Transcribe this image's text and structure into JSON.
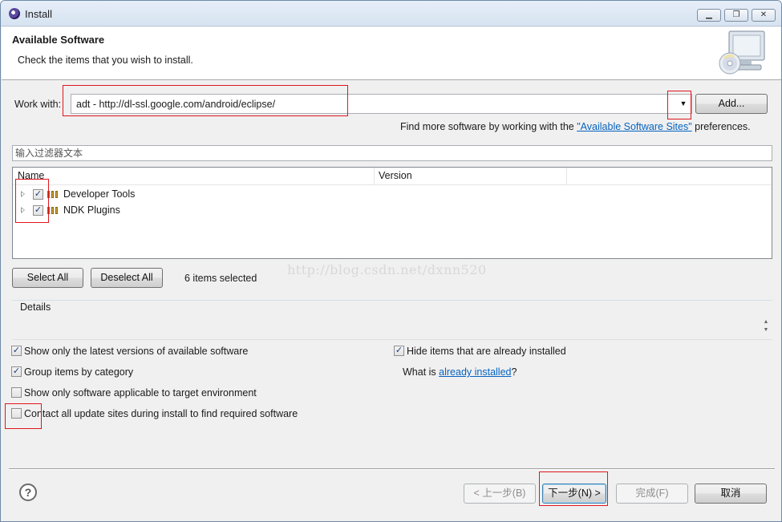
{
  "window": {
    "title": "Install",
    "controls": {
      "minimize": "▁",
      "maximize": "❐",
      "close": "✕"
    }
  },
  "banner": {
    "title": "Available Software",
    "subtitle": "Check the items that you wish to install."
  },
  "work_with": {
    "label": "Work with:",
    "value": "adt - http://dl-ssl.google.com/android/eclipse/",
    "add_button": "Add...",
    "more_text_before": "Find more software by working with the ",
    "more_link": "\"Available Software Sites\"",
    "more_text_after": " preferences."
  },
  "filter": {
    "placeholder": "输入过滤器文本"
  },
  "tree": {
    "columns": [
      "Name",
      "Version"
    ],
    "items": [
      {
        "label": "Developer Tools",
        "checked": true
      },
      {
        "label": "NDK Plugins",
        "checked": true
      }
    ]
  },
  "selection": {
    "select_all": "Select All",
    "deselect_all": "Deselect All",
    "count_text": "6 items selected"
  },
  "watermark": "http://blog.csdn.net/dxnn520",
  "details": {
    "label": "Details"
  },
  "options": {
    "latest_versions": {
      "label": "Show only the latest versions of available software",
      "checked": true
    },
    "group_by_category": {
      "label": "Group items by category",
      "checked": true
    },
    "target_environment": {
      "label": "Show only software applicable to target environment",
      "checked": false
    },
    "contact_sites": {
      "label": "Contact all update sites during install to find required software",
      "checked": false
    },
    "hide_installed": {
      "label": "Hide items that are already installed",
      "checked": true
    },
    "what_is_prefix": "What is ",
    "what_is_link": "already installed",
    "what_is_suffix": "?"
  },
  "footer": {
    "help": "?",
    "back": "< 上一步(B)",
    "next": "下一步(N) >",
    "finish": "完成(F)",
    "cancel": "取消"
  },
  "colors": {
    "annotation": "#e0161e",
    "link": "#0563c1",
    "check": "#1f3a7d"
  }
}
